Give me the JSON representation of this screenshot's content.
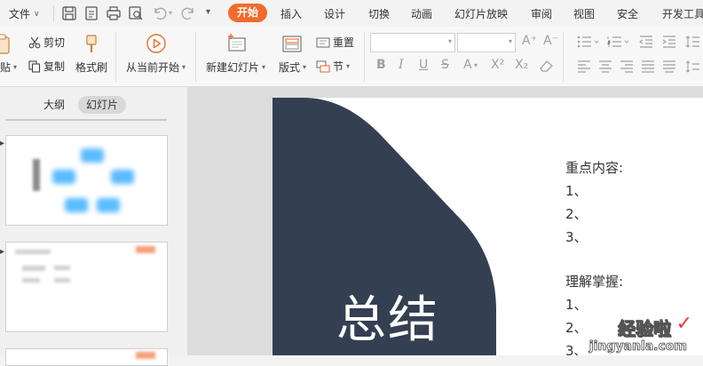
{
  "menubar": {
    "file_label": "文件",
    "tabs": [
      "开始",
      "插入",
      "设计",
      "切换",
      "动画",
      "幻灯片放映",
      "审阅",
      "视图",
      "安全",
      "开发工具"
    ],
    "active_tab": "开始",
    "accent_color": "#f06b2c"
  },
  "ribbon": {
    "paste_label": "贴",
    "cut_label": "剪切",
    "copy_label": "复制",
    "format_painter_label": "格式刷",
    "start_from_current_label": "从当前开始",
    "new_slide_label": "新建幻灯片",
    "layout_label": "版式",
    "reset_label": "重置",
    "section_label": "节"
  },
  "left_panel": {
    "tab_outline": "大纲",
    "tab_slides": "幻灯片"
  },
  "slide": {
    "title": "总结",
    "key_content_heading": "重点内容:",
    "key_items": [
      "1、",
      "2、",
      "3、"
    ],
    "understand_heading": "理解掌握:",
    "understand_items": [
      "1、",
      "2、",
      "3、"
    ],
    "shape_color": "#343f52"
  },
  "watermark": {
    "main": "经验啦",
    "url": "jingyanla.com"
  }
}
